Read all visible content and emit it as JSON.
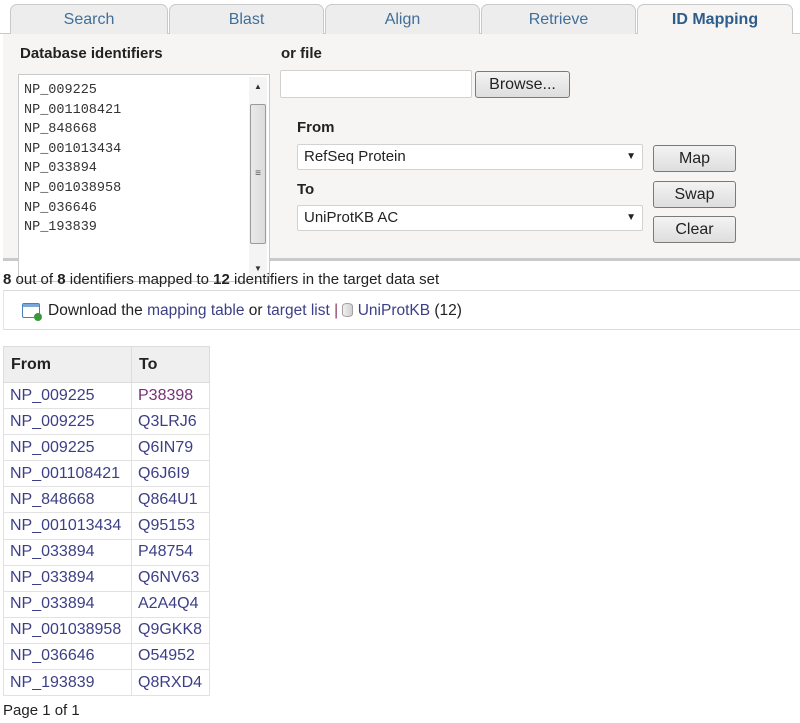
{
  "tabs": [
    {
      "label": "Search",
      "active": false
    },
    {
      "label": "Blast",
      "active": false
    },
    {
      "label": "Align",
      "active": false
    },
    {
      "label": "Retrieve",
      "active": false
    },
    {
      "label": "ID Mapping",
      "active": true
    }
  ],
  "form": {
    "identifiers_label": "Database identifiers",
    "identifiers": [
      "NP_009225",
      "NP_001108421",
      "NP_848668",
      "NP_001013434",
      "NP_033894",
      "NP_001038958",
      "NP_036646",
      "NP_193839"
    ],
    "file_label": "or file",
    "file_value": "",
    "browse_label": "Browse...",
    "from_label": "From",
    "from_value": "RefSeq Protein",
    "to_label": "To",
    "to_value": "UniProtKB AC",
    "map_label": "Map",
    "swap_label": "Swap",
    "clear_label": "Clear",
    "scroll_up_icon": "▲",
    "scroll_down_icon": "▼",
    "scroll_grip_icon": "≡",
    "caret_icon": "▼"
  },
  "summary": {
    "mapped": "8",
    "text1": " out of ",
    "total": "8",
    "text2": " identifiers mapped to ",
    "target_count": "12",
    "text3": " identifiers in the target data set"
  },
  "download": {
    "prefix": "Download the ",
    "mapping_table": "mapping table",
    "or": " or ",
    "target_list": "target list",
    "separator": " | ",
    "db_link": "UniProtKB",
    "db_count": " (12)"
  },
  "table": {
    "headers": [
      "From",
      "To"
    ],
    "rows": [
      [
        "NP_009225",
        "P38398"
      ],
      [
        "NP_009225",
        "Q3LRJ6"
      ],
      [
        "NP_009225",
        "Q6IN79"
      ],
      [
        "NP_001108421",
        "Q6J6I9"
      ],
      [
        "NP_848668",
        "Q864U1"
      ],
      [
        "NP_001013434",
        "Q95153"
      ],
      [
        "NP_033894",
        "P48754"
      ],
      [
        "NP_033894",
        "Q6NV63"
      ],
      [
        "NP_033894",
        "A2A4Q4"
      ],
      [
        "NP_001038958",
        "Q9GKK8"
      ],
      [
        "NP_036646",
        "O54952"
      ],
      [
        "NP_193839",
        "Q8RXD4"
      ]
    ],
    "visited_color": "#7a2e78",
    "link_color": "#3c3f86"
  },
  "pager": "Page 1 of 1"
}
